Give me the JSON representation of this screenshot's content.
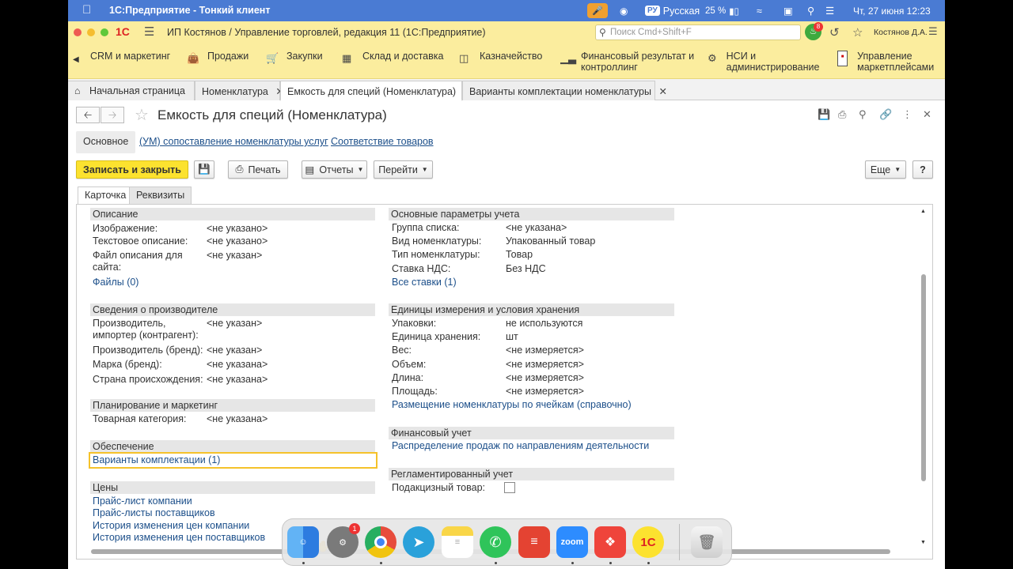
{
  "mac_menubar": {
    "app_name": "1С:Предприятие - Тонкий клиент",
    "language_code": "РУ",
    "language_name": "Русская",
    "battery": "25 %",
    "datetime": "Чт, 27 июня  12:23"
  },
  "window": {
    "title": "ИП Костянов / Управление торговлей, редакция 11  (1С:Предприятие)",
    "search_placeholder": "Поиск Cmd+Shift+F",
    "notifications_count": "8",
    "user": "Костянов Д.А."
  },
  "sections": [
    {
      "label": "CRM и маркетинг",
      "icon": "crm-icon"
    },
    {
      "label": "Продажи",
      "icon": "bag-icon"
    },
    {
      "label": "Закупки",
      "icon": "cart-icon"
    },
    {
      "label": "Склад и доставка",
      "icon": "warehouse-icon"
    },
    {
      "label": "Казначейство",
      "icon": "treasury-icon"
    },
    {
      "label": "Финансовый результат и контроллинг",
      "icon": "chart-icon"
    },
    {
      "label": "НСИ и администрирование",
      "icon": "gear-icon"
    },
    {
      "label": "Управление маркетплейсами",
      "icon": "marketplace-icon"
    }
  ],
  "open_tabs": [
    {
      "label": "Начальная страница"
    },
    {
      "label": "Номенклатура"
    },
    {
      "label": "Емкость для специй (Номенклатура)"
    },
    {
      "label": "Варианты комплектации номенклатуры"
    }
  ],
  "form": {
    "title": "Емкость для специй (Номенклатура)",
    "subnav": [
      "Основное",
      "(УМ) сопоставление номенклатуры услуг",
      "Соответствие товаров"
    ],
    "commands": {
      "save_close": "Записать и закрыть",
      "print": "Печать",
      "reports": "Отчеты",
      "goto": "Перейти",
      "more": "Еще",
      "help": "?"
    },
    "tabs": [
      "Карточка",
      "Реквизиты"
    ]
  },
  "left": {
    "description": {
      "title": "Описание",
      "image_label": "Изображение:",
      "image_value": "<не указано>",
      "text_label": "Текстовое описание:",
      "text_value": "<не указано>",
      "file_label_1": "Файл описания для",
      "file_label_2": "сайта:",
      "file_value": "<не указан>",
      "files_link": "Файлы (0)"
    },
    "manufacturer": {
      "title": "Сведения о производителе",
      "producer_label_1": "Производитель,",
      "producer_label_2": "импортер (контрагент):",
      "producer_value": "<не указан>",
      "brand_producer_label": "Производитель (бренд):",
      "brand_producer_value": "<не указан>",
      "brand_label": "Марка (бренд):",
      "brand_value": "<не указана>",
      "country_label": "Страна происхождения:",
      "country_value": "<не указана>"
    },
    "planning": {
      "title": "Планирование и маркетинг",
      "category_label": "Товарная категория:",
      "category_value": "<не указана>"
    },
    "supply": {
      "title": "Обеспечение",
      "variants_link": "Варианты комплектации (1)"
    },
    "prices": {
      "title": "Цены",
      "links": [
        "Прайс-лист компании",
        "Прайс-листы поставщиков",
        "История изменения цен компании",
        "История изменения цен поставщиков"
      ]
    }
  },
  "right": {
    "main_params": {
      "title": "Основные параметры учета",
      "group_label": "Группа списка:",
      "group_value": "<не указана>",
      "kind_label": "Вид номенклатуры:",
      "kind_value": "Упакованный товар",
      "type_label": "Тип номенклатуры:",
      "type_value": "Товар",
      "vat_label": "Ставка НДС:",
      "vat_value": "Без НДС",
      "all_rates_link": "Все ставки (1)"
    },
    "units": {
      "title": "Единицы измерения и условия хранения",
      "pack_label": "Упаковки:",
      "pack_value": "не используются",
      "unit_label": "Единица хранения:",
      "unit_value": "шт",
      "weight_label": "Вес:",
      "weight_value": "<не измеряется>",
      "volume_label": "Объем:",
      "volume_value": "<не измеряется>",
      "length_label": "Длина:",
      "length_value": "<не измеряется>",
      "area_label": "Площадь:",
      "area_value": "<не измеряется>",
      "placement_link": "Размещение номенклатуры по ячейкам (справочно)"
    },
    "finance": {
      "title": "Финансовый учет",
      "distribution_link": "Распределение продаж по направлениям деятельности"
    },
    "regulated": {
      "title": "Регламентированный учет",
      "excise_label": "Подакцизный товар:"
    }
  },
  "dock": {
    "apps": [
      "finder",
      "settings",
      "chrome",
      "telegram",
      "notes",
      "whatsapp",
      "todoist",
      "zoom",
      "anydesk",
      "1c",
      "trash"
    ],
    "settings_badge": "1",
    "zoom_label": "zoom",
    "onec_label": "1С"
  },
  "colors": {
    "mac_bar": "#4a7bd3",
    "onec_yellow": "#fbed9e",
    "primary_button": "#fce22f",
    "link": "#1c4f8a",
    "selection": "#f5c22a"
  }
}
